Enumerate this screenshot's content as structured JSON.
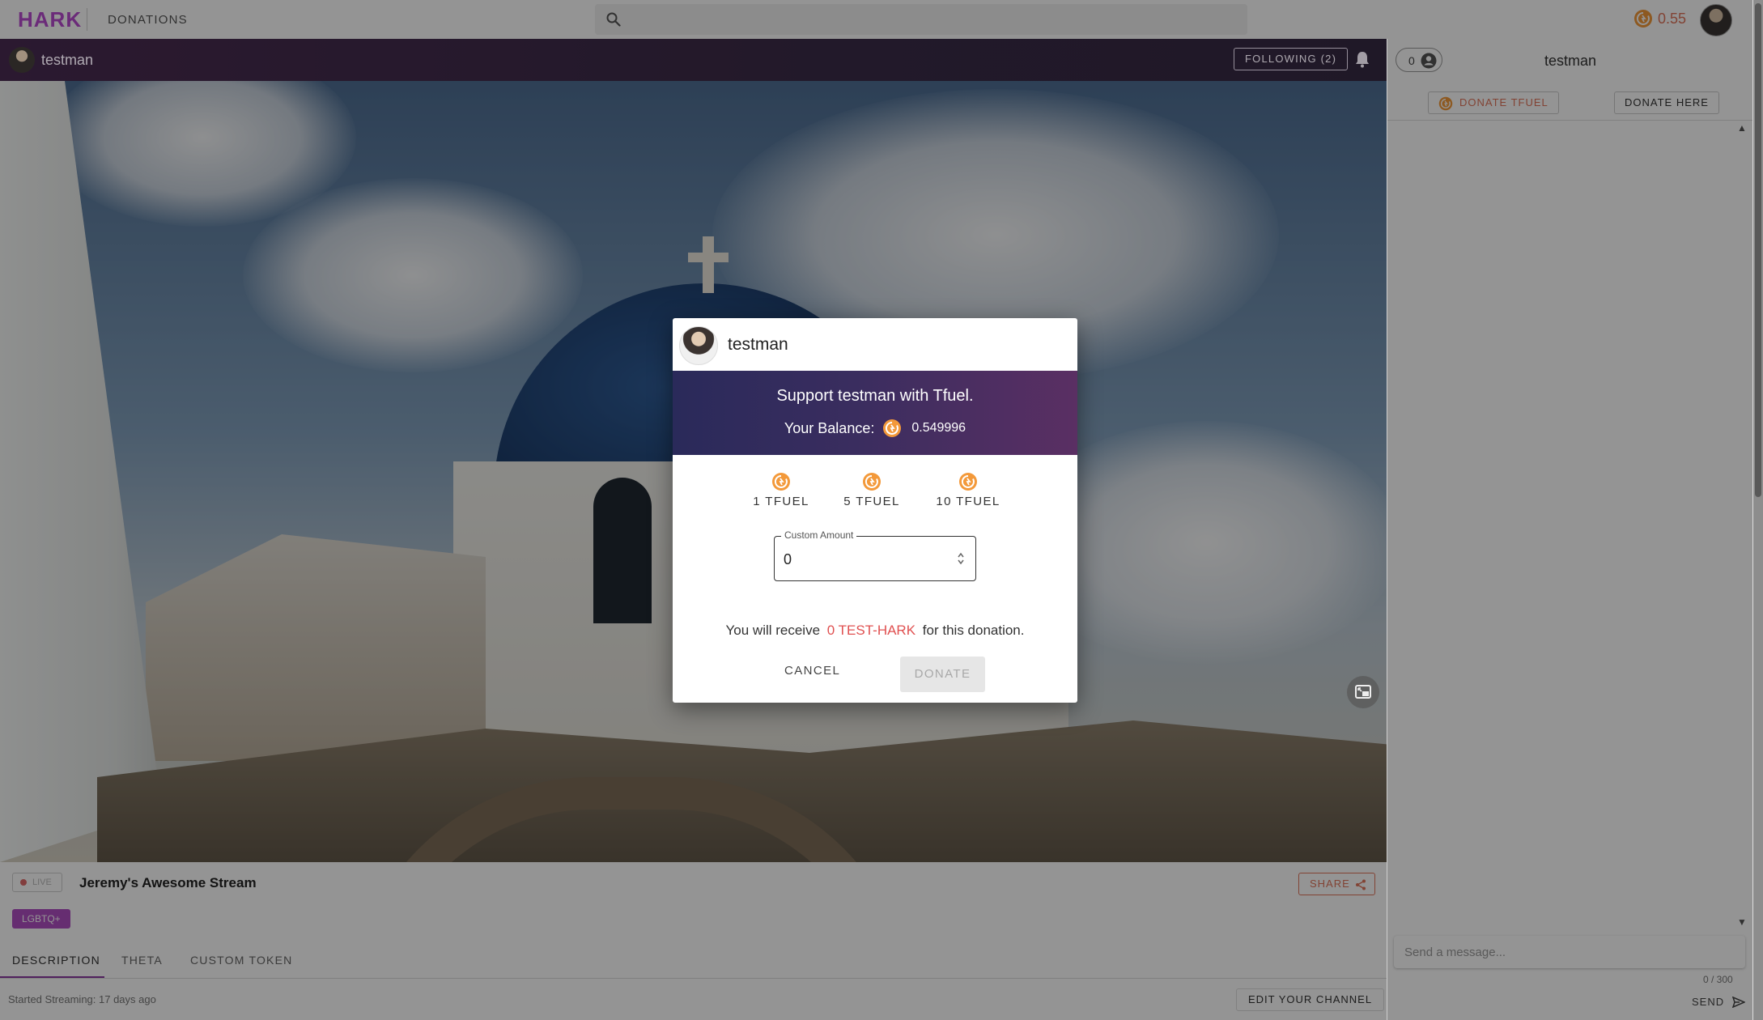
{
  "header": {
    "logo": "HARK",
    "nav_donations": "DONATIONS",
    "search_placeholder": "",
    "balance": "0.55"
  },
  "channel": {
    "name": "testman",
    "following_label": "FOLLOWING (2)"
  },
  "stream": {
    "live_label": "LIVE",
    "title": "Jeremy's Awesome Stream",
    "share_label": "SHARE",
    "tag": "LGBTQ+",
    "tabs": [
      {
        "label": "DESCRIPTION",
        "active": true
      },
      {
        "label": "THETA",
        "active": false
      },
      {
        "label": "CUSTOM TOKEN",
        "active": false
      }
    ],
    "started": "Started Streaming: 17 days ago",
    "edit_channel_label": "EDIT YOUR CHANNEL"
  },
  "chat": {
    "viewer_count": "0",
    "title": "testman",
    "donate_tfuel_label": "DONATE TFUEL",
    "donate_here_label": "DONATE HERE",
    "input_placeholder": "Send a message...",
    "char_count": "0 / 300",
    "send_label": "SEND"
  },
  "modal": {
    "username": "testman",
    "heading": "Support testman with Tfuel.",
    "balance_label": "Your Balance:",
    "balance_value": "0.549996",
    "presets": [
      "1 TFUEL",
      "5 TFUEL",
      "10 TFUEL"
    ],
    "custom_label": "Custom Amount",
    "custom_value": "0",
    "receive_prefix": "You will receive",
    "receive_amount": "0 TEST-HARK",
    "receive_suffix": "for this donation.",
    "cancel_label": "CANCEL",
    "donate_label": "DONATE"
  },
  "colors": {
    "brand_purple": "#b84bd0",
    "tfuel_orange": "#f3993a",
    "accent_coral": "#e0745a",
    "banner_start": "#2a2a5a",
    "banner_end": "#5a2f63"
  },
  "icons": {
    "search": "search-icon",
    "bell": "bell-icon",
    "tfuel_coin": "tfuel-coin-icon",
    "share": "share-icon",
    "viewer": "person-icon",
    "send": "send-icon",
    "pip": "picture-in-picture-icon"
  }
}
